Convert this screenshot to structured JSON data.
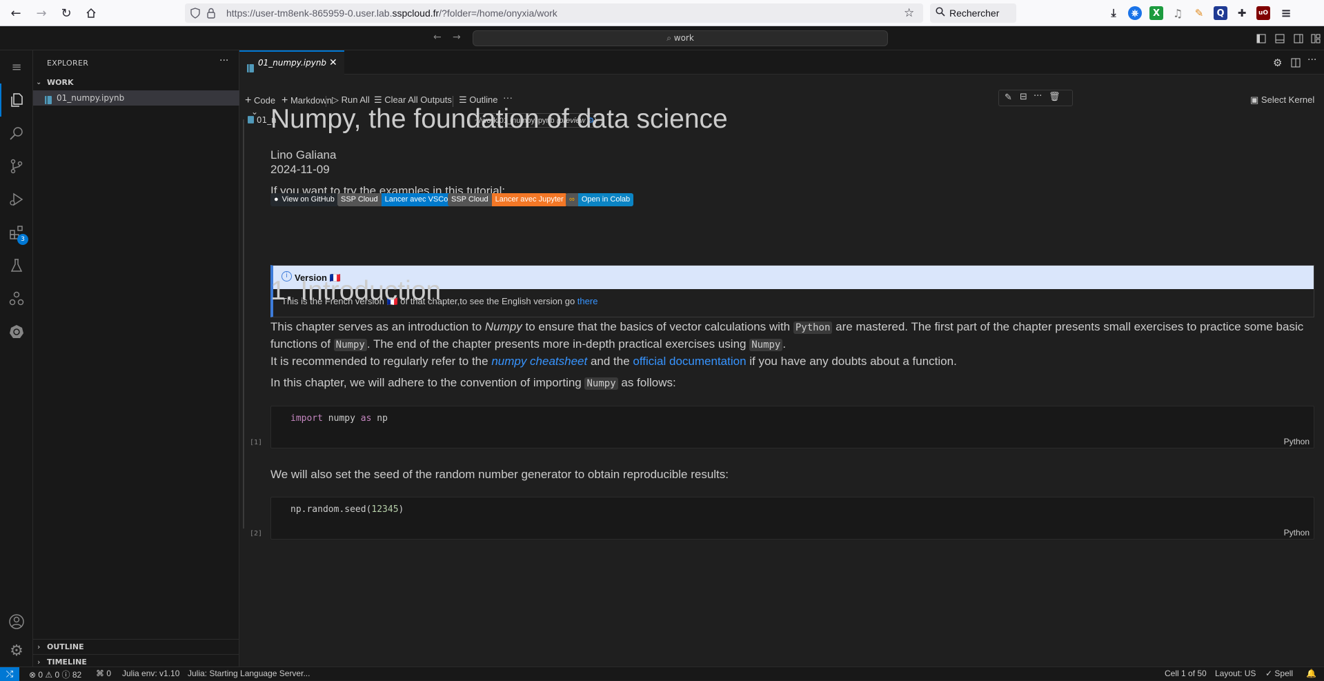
{
  "browser": {
    "url_prefix": "https://user-tm8enk-865959-0.user.lab.",
    "url_domain": "sspcloud.fr",
    "url_suffix": "/?folder=/home/onyxia/work",
    "search_label": "Rechercher"
  },
  "titlebar": {
    "command_center": "work"
  },
  "activity": {
    "extensions_badge": "3"
  },
  "sidebar": {
    "title": "EXPLORER",
    "folder": "WORK",
    "file": "01_numpy.ipynb",
    "outline": "OUTLINE",
    "timeline": "TIMELINE"
  },
  "editor": {
    "tab_label": "01_numpy.ipynb",
    "breadcrumb": "01_n",
    "tooltip": "~/work/01_numpy.ipynb",
    "tooltip_preview": "(preview",
    "tooltip_end": ")",
    "toolbar": {
      "code": "Code",
      "markdown": "Markdown",
      "run_all": "Run All",
      "clear": "Clear All Outputs",
      "outline": "Outline",
      "kernel": "Select Kernel"
    }
  },
  "notebook": {
    "title": "Numpy, the foundation of data science",
    "author": "Lino Galiana",
    "date": "2024-11-09",
    "try_text": "If you want to try the examples in this tutorial:",
    "badges": {
      "github": "View on GitHub",
      "ssp1_left": "SSP Cloud",
      "ssp1_right": "Lancer avec VSCode",
      "ssp2_left": "SSP Cloud",
      "ssp2_right": "Lancer avec Jupyter",
      "colab": "Open in Colab"
    },
    "callout": {
      "title": "Version 🇫🇷",
      "body_a": "This is the French version 🇫🇷 of that chapter,to see the English version go ",
      "body_link": "there"
    },
    "intro_heading": "1. Introduction",
    "p1_a": "This chapter serves as an introduction to ",
    "p1_em": "Numpy",
    "p1_b": " to ensure that the basics of vector calculations with ",
    "p1_code1": "Python",
    "p1_c": " are mastered. The first part of the chapter presents small exercises to practice some basic functions of ",
    "p1_code2": "Numpy",
    "p1_d": ". The end of the chapter presents more in-depth practical exercises using ",
    "p1_code3": "Numpy",
    "p1_e": ".",
    "p2_a": "It is recommended to regularly refer to the ",
    "p2_link1": "numpy cheatsheet",
    "p2_b": " and the ",
    "p2_link2": "official documentation",
    "p2_c": " if you have any doubts about a function.",
    "p3_a": "In this chapter, we will adhere to the convention of importing ",
    "p3_code": "Numpy",
    "p3_b": " as follows:",
    "cell1": {
      "kw1": "import",
      "mod": " numpy ",
      "kw2": "as",
      "alias": " np",
      "exec": "[1]",
      "lang": "Python"
    },
    "p4": "We will also set the seed of the random number generator to obtain reproducible results:",
    "cell2": {
      "call": "np.random.seed(",
      "num": "12345",
      "close": ")",
      "exec": "[2]",
      "lang": "Python"
    }
  },
  "status": {
    "problems": "0",
    "warnings": "0",
    "info": "82",
    "ports": "0",
    "julia_env": "Julia env: v1.10",
    "julia_status": "Julia: Starting Language Server...",
    "cell": "Cell 1 of 50",
    "layout": "Layout: US",
    "spell": "Spell"
  }
}
